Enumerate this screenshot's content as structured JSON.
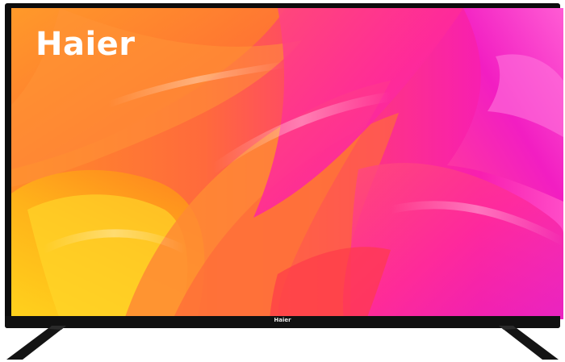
{
  "screen": {
    "brand_logo": "Haier"
  },
  "bezel": {
    "brand_logo": "Haier"
  },
  "colors": {
    "frame": "#0c0c0c",
    "orange": "#ff8a1e",
    "yellow": "#ffc21a",
    "pink": "#ff2a9a",
    "magenta": "#f21ec2",
    "red": "#ff3a4a"
  }
}
